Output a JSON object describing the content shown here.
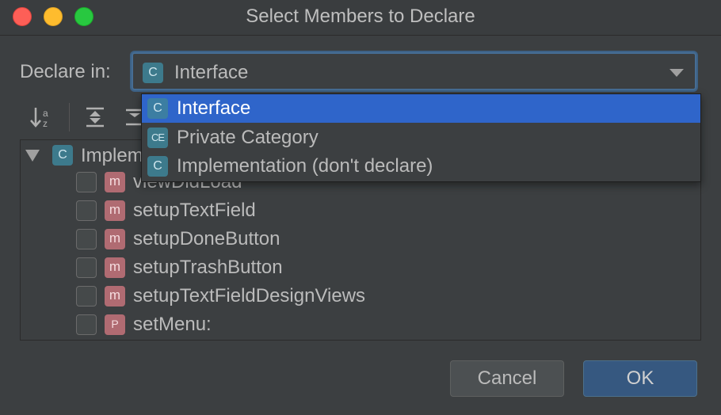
{
  "window": {
    "title": "Select Members to Declare"
  },
  "declare": {
    "label": "Declare in:",
    "selected": "Interface"
  },
  "dropdown": {
    "options": [
      {
        "label": "Interface",
        "icon": "class-icon",
        "selected": true
      },
      {
        "label": "Private Category",
        "icon": "category-icon",
        "selected": false
      },
      {
        "label": "Implementation (don't declare)",
        "icon": "class-icon",
        "selected": false
      }
    ]
  },
  "icons": {
    "class_letter": "C",
    "category_letters": "CE",
    "method_letter": "m",
    "property_letter": "P"
  },
  "tree": {
    "root_label": "Implem",
    "members": [
      {
        "label": "viewDidLoad",
        "kind": "m",
        "checked": false
      },
      {
        "label": "setupTextField",
        "kind": "m",
        "checked": false
      },
      {
        "label": "setupDoneButton",
        "kind": "m",
        "checked": false
      },
      {
        "label": "setupTrashButton",
        "kind": "m",
        "checked": false
      },
      {
        "label": "setupTextFieldDesignViews",
        "kind": "m",
        "checked": false
      },
      {
        "label": "setMenu:",
        "kind": "P",
        "checked": false
      }
    ]
  },
  "buttons": {
    "cancel": "Cancel",
    "ok": "OK"
  },
  "colors": {
    "selection": "#2f65ca",
    "class_icon": "#3d7a8c",
    "method_icon": "#b06b72",
    "focus_ring": "#466d94"
  }
}
